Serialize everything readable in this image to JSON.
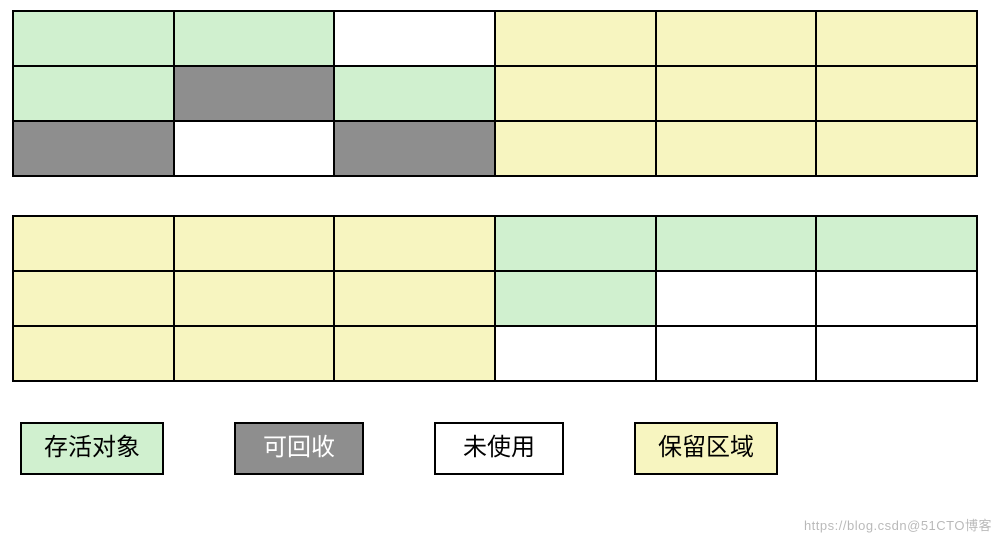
{
  "colors": {
    "alive": "#d0f0cf",
    "reclaim": "#8e8e8e",
    "unused": "#ffffff",
    "reserved": "#f7f5c0"
  },
  "grid_top": [
    [
      "alive",
      "alive",
      "unused",
      "reserved",
      "reserved",
      "reserved"
    ],
    [
      "alive",
      "reclaim",
      "alive",
      "reserved",
      "reserved",
      "reserved"
    ],
    [
      "reclaim",
      "unused",
      "reclaim",
      "reserved",
      "reserved",
      "reserved"
    ]
  ],
  "grid_bottom": [
    [
      "reserved",
      "reserved",
      "reserved",
      "alive",
      "alive",
      "alive"
    ],
    [
      "reserved",
      "reserved",
      "reserved",
      "alive",
      "unused",
      "unused"
    ],
    [
      "reserved",
      "reserved",
      "reserved",
      "unused",
      "unused",
      "unused"
    ]
  ],
  "legend": [
    {
      "key": "alive",
      "label": "存活对象",
      "textColor": "#000000"
    },
    {
      "key": "reclaim",
      "label": "可回收",
      "textColor": "#ffffff"
    },
    {
      "key": "unused",
      "label": "未使用",
      "textColor": "#000000"
    },
    {
      "key": "reserved",
      "label": "保留区域",
      "textColor": "#000000"
    }
  ],
  "watermark": "https://blog.csdn@51CTO博客"
}
